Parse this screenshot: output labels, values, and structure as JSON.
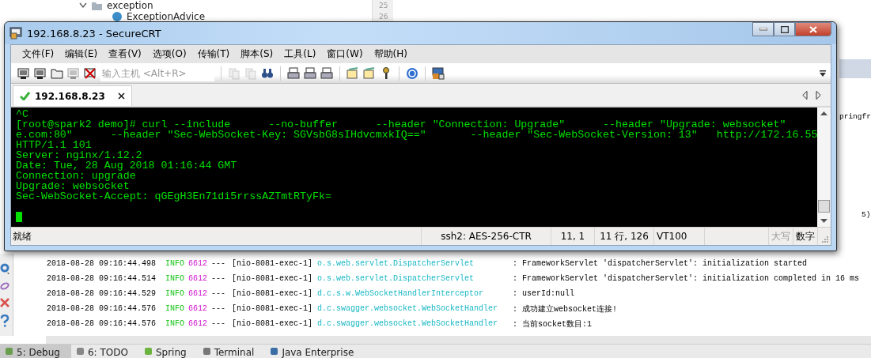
{
  "ide": {
    "tree": [
      {
        "label": "exception",
        "kind": "folder",
        "expanded": true
      },
      {
        "label": "ExceptionAdvice",
        "kind": "class"
      }
    ],
    "line_numbers": [
      "25",
      "26"
    ],
    "fragments": [
      "pringfr",
      "5)"
    ],
    "log_rows": [
      {
        "timestamp": "2018-08-28 09:16:44.498",
        "level": "INFO",
        "pid": "6612",
        "separator": "---",
        "thread": "[nio-8081-exec-1]",
        "logger": "o.s.web.servlet.DispatcherServlet",
        "message": ": FrameworkServlet 'dispatcherServlet': initialization started"
      },
      {
        "timestamp": "2018-08-28 09:16:44.514",
        "level": "INFO",
        "pid": "6612",
        "separator": "---",
        "thread": "[nio-8081-exec-1]",
        "logger": "o.s.web.servlet.DispatcherServlet",
        "message": ": FrameworkServlet 'dispatcherServlet': initialization completed in 16 ms"
      },
      {
        "timestamp": "2018-08-28 09:16:44.529",
        "level": "INFO",
        "pid": "6612",
        "separator": "---",
        "thread": "[nio-8081-exec-1]",
        "logger": "d.c.s.w.WebSocketHandlerInterceptor",
        "message": ": userId:null"
      },
      {
        "timestamp": "2018-08-28 09:16:44.576",
        "level": "INFO",
        "pid": "6612",
        "separator": "---",
        "thread": "[nio-8081-exec-1]",
        "logger": "d.c.swagger.websocket.WebSocketHandler",
        "message": ": 成功建立websocket连接!"
      },
      {
        "timestamp": "2018-08-28 09:16:44.576",
        "level": "INFO",
        "pid": "6612",
        "separator": "---",
        "thread": "[nio-8081-exec-1]",
        "logger": "d.c.swagger.websocket.WebSocketHandler",
        "message": ": 当前socket数目:1"
      }
    ],
    "bottom_tabs": [
      {
        "label": "5: Debug",
        "selected": true
      },
      {
        "label": "6: TODO",
        "selected": false
      },
      {
        "label": "Spring",
        "selected": false
      },
      {
        "label": "Terminal",
        "selected": false
      },
      {
        "label": "Java Enterprise",
        "selected": false
      }
    ]
  },
  "window": {
    "title": "192.168.8.23 - SecureCRT",
    "menu": [
      "文件(F)",
      "编辑(E)",
      "查看(V)",
      "选项(O)",
      "传输(T)",
      "脚本(S)",
      "工具(L)",
      "窗口(W)",
      "帮助(H)"
    ],
    "host_field": {
      "placeholder": "输入主机 <Alt+R>"
    },
    "tabs": [
      {
        "label": "192.168.8.23",
        "selected": true,
        "connected": true
      }
    ],
    "terminal": {
      "lines": [
        "^C",
        "[root@spark2 demo]# curl --include      --no-buffer      --header \"Connection: Upgrade\"      --header \"Upgrade: websocket\"",
        "e.com:80\"      --header \"Sec-WebSocket-Key: SGVsbG8sIHdvcmxkIQ==\"       --header \"Sec-WebSocket-Version: 13\"   http://172.16.55",
        "HTTP/1.1 101",
        "Server: nginx/1.12.2",
        "Date: Tue, 28 Aug 2018 01:16:44 GMT",
        "Connection: upgrade",
        "Upgrade: websocket",
        "Sec-WebSocket-Accept: qGEgH3En71di5rrssAZTmtRTyFk="
      ],
      "cursor_visible": true
    },
    "status_bar": [
      {
        "text": "就绪",
        "kind": "message",
        "disabled": false
      },
      {
        "text": "ssh2: AES-256-CTR",
        "kind": "cell",
        "disabled": false
      },
      {
        "text": "11,  1",
        "kind": "cell",
        "disabled": false
      },
      {
        "text": "11 行, 126",
        "kind": "cell",
        "disabled": false
      },
      {
        "text": "VT100",
        "kind": "cell",
        "disabled": false
      },
      {
        "kind": "blank"
      },
      {
        "text": "大写",
        "kind": "key",
        "disabled": true
      },
      {
        "text": "数字",
        "kind": "key",
        "disabled": false
      }
    ]
  }
}
